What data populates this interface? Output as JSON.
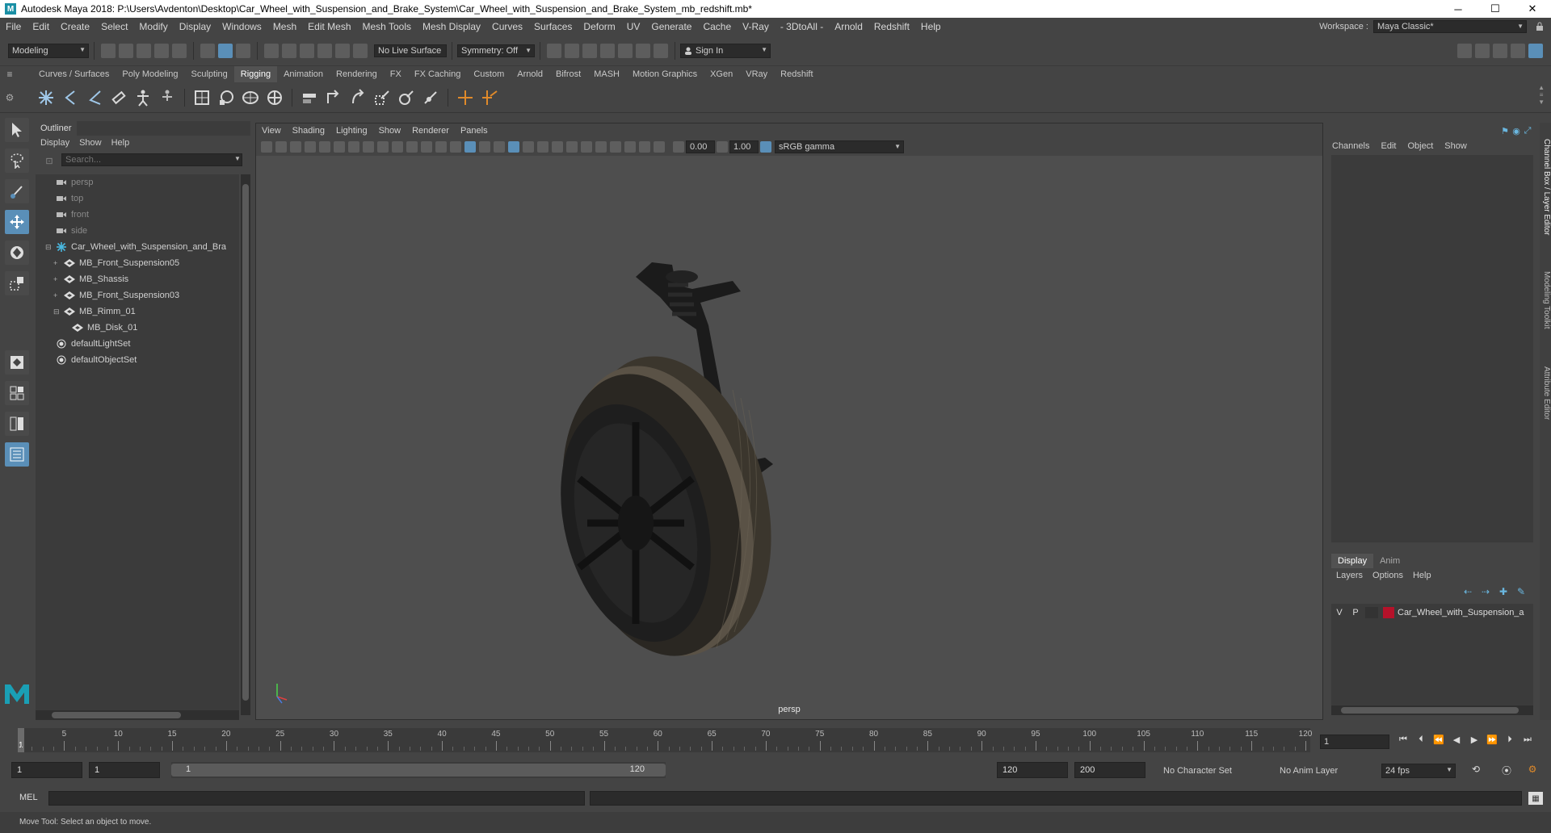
{
  "titlebar": {
    "title": "Autodesk Maya 2018: P:\\Users\\Avdenton\\Desktop\\Car_Wheel_with_Suspension_and_Brake_System\\Car_Wheel_with_Suspension_and_Brake_System_mb_redshift.mb*",
    "min": "─",
    "max": "☐",
    "close": "✕"
  },
  "menubar": {
    "items": [
      "File",
      "Edit",
      "Create",
      "Select",
      "Modify",
      "Display",
      "Windows",
      "Mesh",
      "Edit Mesh",
      "Mesh Tools",
      "Mesh Display",
      "Curves",
      "Surfaces",
      "Deform",
      "UV",
      "Generate",
      "Cache",
      "V-Ray",
      "- 3DtoAll -",
      "Arnold",
      "Redshift",
      "Help"
    ],
    "workspace_label": "Workspace :",
    "workspace_value": "Maya Classic*"
  },
  "statusline": {
    "mode": "Modeling",
    "live_surface": "No Live Surface",
    "symmetry": "Symmetry: Off",
    "sign_in": "Sign In"
  },
  "shelf": {
    "tabs": [
      "Curves / Surfaces",
      "Poly Modeling",
      "Sculpting",
      "Rigging",
      "Animation",
      "Rendering",
      "FX",
      "FX Caching",
      "Custom",
      "Arnold",
      "Bifrost",
      "MASH",
      "Motion Graphics",
      "XGen",
      "VRay",
      "Redshift"
    ],
    "active_tab": "Rigging"
  },
  "outliner": {
    "title": "Outliner",
    "menu": [
      "Display",
      "Show",
      "Help"
    ],
    "search_placeholder": "Search...",
    "items": [
      {
        "label": "persp",
        "indent": 0,
        "dim": true,
        "icon": "camera-icon"
      },
      {
        "label": "top",
        "indent": 0,
        "dim": true,
        "icon": "camera-icon"
      },
      {
        "label": "front",
        "indent": 0,
        "dim": true,
        "icon": "camera-icon"
      },
      {
        "label": "side",
        "indent": 0,
        "dim": true,
        "icon": "camera-icon"
      },
      {
        "label": "Car_Wheel_with_Suspension_and_Bra",
        "indent": 0,
        "dim": false,
        "icon": "group-icon"
      },
      {
        "label": "MB_Front_Suspension05",
        "indent": 1,
        "dim": false,
        "icon": "mesh-icon"
      },
      {
        "label": "MB_Shassis",
        "indent": 1,
        "dim": false,
        "icon": "mesh-icon"
      },
      {
        "label": "MB_Front_Suspension03",
        "indent": 1,
        "dim": false,
        "icon": "mesh-icon"
      },
      {
        "label": "MB_Rimm_01",
        "indent": 1,
        "dim": false,
        "icon": "mesh-icon"
      },
      {
        "label": "MB_Disk_01",
        "indent": 2,
        "dim": false,
        "icon": "mesh-icon"
      },
      {
        "label": "defaultLightSet",
        "indent": 0,
        "dim": false,
        "icon": "set-icon"
      },
      {
        "label": "defaultObjectSet",
        "indent": 0,
        "dim": false,
        "icon": "set-icon"
      }
    ]
  },
  "viewport": {
    "menu": [
      "View",
      "Shading",
      "Lighting",
      "Show",
      "Renderer",
      "Panels"
    ],
    "exposure": "0.00",
    "gamma": "1.00",
    "color_space": "sRGB gamma",
    "camera_label": "persp"
  },
  "channelbox": {
    "menu": [
      "Channels",
      "Edit",
      "Object",
      "Show"
    ],
    "layer_tabs": [
      "Display",
      "Anim"
    ],
    "layer_menu": [
      "Layers",
      "Options",
      "Help"
    ],
    "layer": {
      "v": "V",
      "p": "P",
      "name": "Car_Wheel_with_Suspension_a",
      "color": "#b5122a"
    },
    "side_tabs": [
      "Channel Box / Layer Editor",
      "Modeling Toolkit",
      "Attribute Editor"
    ]
  },
  "timeslider": {
    "labels": [
      "5",
      "10",
      "15",
      "20",
      "25",
      "30",
      "35",
      "40",
      "45",
      "50",
      "55",
      "60",
      "65",
      "70",
      "75",
      "80",
      "85",
      "90",
      "95",
      "100",
      "105",
      "110",
      "115",
      "120"
    ],
    "current_frame": "1",
    "frame_field": "1"
  },
  "rangeslider": {
    "start": "1",
    "start2": "1",
    "range_start": "1",
    "range_end": "120",
    "end": "120",
    "end2": "200",
    "character_set": "No Character Set",
    "anim_layer": "No Anim Layer",
    "fps": "24 fps"
  },
  "cmdline": {
    "label": "MEL"
  },
  "helpline": {
    "text": "Move Tool: Select an object to move."
  },
  "colors": {
    "accent": "#5a8fb8",
    "bg": "#444444",
    "panel": "#3b3b3b",
    "maya_logo": "#1a9fb5"
  }
}
